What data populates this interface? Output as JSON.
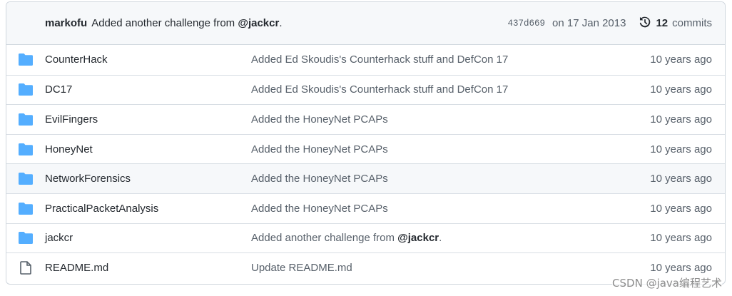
{
  "commit_bar": {
    "author": "markofu",
    "message_prefix": "Added another challenge from ",
    "mention": "@jackcr",
    "message_suffix": ".",
    "sha": "437d669",
    "date": "on 17 Jan 2013",
    "commit_count": "12",
    "commits_label": "commits"
  },
  "files": [
    {
      "name": "CounterHack",
      "type": "folder",
      "message": "Added Ed Skoudis's Counterhack stuff and DefCon 17",
      "age": "10 years ago"
    },
    {
      "name": "DC17",
      "type": "folder",
      "message": "Added Ed Skoudis's Counterhack stuff and DefCon 17",
      "age": "10 years ago"
    },
    {
      "name": "EvilFingers",
      "type": "folder",
      "message": "Added the HoneyNet PCAPs",
      "age": "10 years ago"
    },
    {
      "name": "HoneyNet",
      "type": "folder",
      "message": "Added the HoneyNet PCAPs",
      "age": "10 years ago"
    },
    {
      "name": "NetworkForensics",
      "type": "folder",
      "message": "Added the HoneyNet PCAPs",
      "age": "10 years ago"
    },
    {
      "name": "PracticalPacketAnalysis",
      "type": "folder",
      "message": "Added the HoneyNet PCAPs",
      "age": "10 years ago"
    },
    {
      "name": "jackcr",
      "type": "folder",
      "message_prefix": "Added another challenge from ",
      "mention": "@jackcr",
      "message_suffix": ".",
      "age": "10 years ago"
    },
    {
      "name": "README.md",
      "type": "file",
      "message": "Update README.md",
      "age": "10 years ago"
    }
  ],
  "watermark": "CSDN @java编程艺术",
  "colors": {
    "folder": "#54aeff",
    "file": "#57606a",
    "border": "#d0d7de",
    "header_bg": "#f6f8fa"
  },
  "icons": {
    "folder": "folder-icon",
    "file": "file-icon",
    "history": "history-icon"
  }
}
